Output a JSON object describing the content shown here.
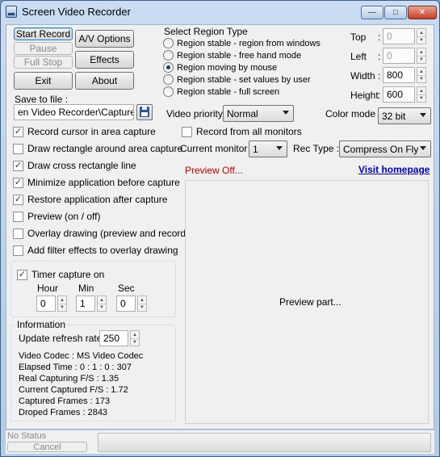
{
  "window": {
    "title": "Screen Video Recorder",
    "minimize_glyph": "—",
    "maximize_glyph": "□",
    "close_glyph": "✕"
  },
  "buttons": {
    "start_record": "Start Record",
    "pause": "Pause",
    "full_stop": "Full Stop",
    "exit": "Exit",
    "av_options": "A/V Options",
    "effects": "Effects",
    "about": "About",
    "save_icon": "floppy-disk-icon"
  },
  "save": {
    "label": "Save to file :",
    "path": "en Video Recorder\\Capture.avi"
  },
  "region": {
    "title": "Select Region Type",
    "options": [
      {
        "label": "Region stable - region from windows",
        "checked": false
      },
      {
        "label": "Region stable - free hand mode",
        "checked": false
      },
      {
        "label": "Region moving by mouse",
        "checked": true
      },
      {
        "label": "Region stable - set values by user",
        "checked": false
      },
      {
        "label": "Region stable - full screen",
        "checked": false
      }
    ]
  },
  "coords": {
    "top": {
      "label": "Top",
      "value": "0",
      "disabled": true
    },
    "left": {
      "label": "Left",
      "value": "0",
      "disabled": true
    },
    "width": {
      "label": "Width",
      "value": "800",
      "disabled": false
    },
    "height": {
      "label": "Height",
      "value": "600",
      "disabled": false
    }
  },
  "video": {
    "priority_label": "Video priority :",
    "priority_value": "Normal",
    "color_label": "Color mode :",
    "color_value": "32 bit",
    "monitor_label": "Current monitor :",
    "monitor_value": "1",
    "rec_label": "Rec Type :",
    "rec_value": "Compress On Fly",
    "record_all_monitors": {
      "label": "Record from all monitors",
      "checked": false
    }
  },
  "options": [
    {
      "label": "Record cursor in area capture",
      "checked": true
    },
    {
      "label": "Draw rectangle around area capture",
      "checked": false
    },
    {
      "label": "Draw cross rectangle line",
      "checked": true
    },
    {
      "label": "Minimize application before capture",
      "checked": true
    },
    {
      "label": "Restore application after capture",
      "checked": true
    },
    {
      "label": "Preview (on / off)",
      "checked": false
    },
    {
      "label": "Overlay drawing (preview and record)",
      "checked": false
    },
    {
      "label": "Add filter effects to overlay drawing",
      "checked": false
    }
  ],
  "timer": {
    "label": "Timer capture on",
    "checked": true,
    "hour_label": "Hour",
    "hour": "0",
    "min_label": "Min",
    "min": "1",
    "sec_label": "Sec",
    "sec": "0"
  },
  "info": {
    "title": "Information",
    "refresh_label": "Update refresh rate :",
    "refresh_value": "250",
    "lines": [
      "Video Codec :  MS Video Codec",
      "Elapsed Time :  0 : 1 : 0 : 307",
      "Real Capturing F/S :  1.35",
      "Current Captured F/S :  1.72",
      "Captured Frames :  173",
      "Droped Frames :  2843"
    ]
  },
  "preview": {
    "status": "Preview Off...",
    "link": "Visit homepage",
    "placeholder": "Preview part..."
  },
  "status": {
    "text": "No Status",
    "cancel": "Cancel"
  },
  "colors": {
    "preview_status": "#c00000",
    "link": "#0000cc"
  }
}
